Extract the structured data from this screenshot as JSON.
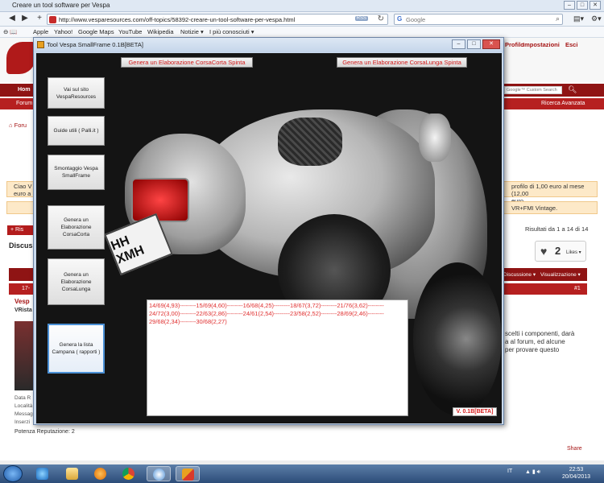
{
  "browser": {
    "window_title": "Creare un tool software per Vespa",
    "url": "http://www.vesparesources.com/off-topics/58392-creare-un-tool-software-per-vespa.html",
    "rss_label": "RSS",
    "search_placeholder": "Google",
    "bookmarks": [
      "Apple",
      "Yahoo!",
      "Google Maps",
      "YouTube",
      "Wikipedia",
      "Notizie ▾",
      "I più conosciuti ▾"
    ]
  },
  "webpage": {
    "top_links": [
      "Profilo",
      "Impostazioni",
      "Esci"
    ],
    "menu_home": "Hom",
    "site_search_placeholder": "Google™ Custom Search",
    "sub_forum": "Forum",
    "ricerca": "Ricerca Avanzata",
    "breadcrumb": "Foru",
    "notice_left": "Ciao V\neuro a",
    "notice_right": "profilo di 1,00 euro al mese (12,00\neuro",
    "notice2_right": "VR+FMI Vintage.",
    "reply_label": "+ Ris",
    "results": "Risultati da 1 a 14 di 14",
    "discussion": "Discuss",
    "likes_count": "2",
    "likes_label": "Likes ▾",
    "thread_tool_a": "Discussione ▾",
    "thread_tool_b": "Visualizzazione ▾",
    "post_date": "17-",
    "post_number": "#1",
    "post_title": "Vesp",
    "username": "VRista",
    "user_info": [
      "Data R",
      "Località",
      "Messag",
      "Inserzi"
    ],
    "reputation": "Potenza Reputazione:   2",
    "post_text": [
      "scelti i componenti, darà",
      "a al forum, ed alcune",
      "",
      "per provare questo"
    ],
    "share": "Share"
  },
  "app": {
    "title": "Tool Vespa SmallFrame 0.1B[BETA]",
    "top_buttons": [
      "Genera un Elaborazione CorsaCorta Spinta",
      "Genera un Elaborazione CorsaLunga Spinta"
    ],
    "side_buttons": [
      "Vai sul sito\nVespaResources",
      "Guide utili ( Palli.it )",
      "Smontaggio Vespa\nSmallFrame",
      "Genera un\nElaborazione\nCorsaCorta",
      "Genera un\nElaborazione\nCorsaLunga",
      "Genera la lista\nCampana ( rapporti )"
    ],
    "plate_text": "HH\nXMH",
    "output_lines": [
      "14/69(4,93)--------15/69(4,60)--------16/68(4,25)--------18/67(3,72)--------21/76(3,62)--------",
      "24/72(3,00)--------22/63(2,86)--------24/61(2,54)--------23/58(2,52)--------28/69(2,46)--------",
      "29/68(2,34)--------30/68(2,27)"
    ],
    "version": "V. 0.1B[BETA]"
  },
  "taskbar": {
    "language": "IT",
    "time": "22:53",
    "date": "20/04/2013"
  }
}
